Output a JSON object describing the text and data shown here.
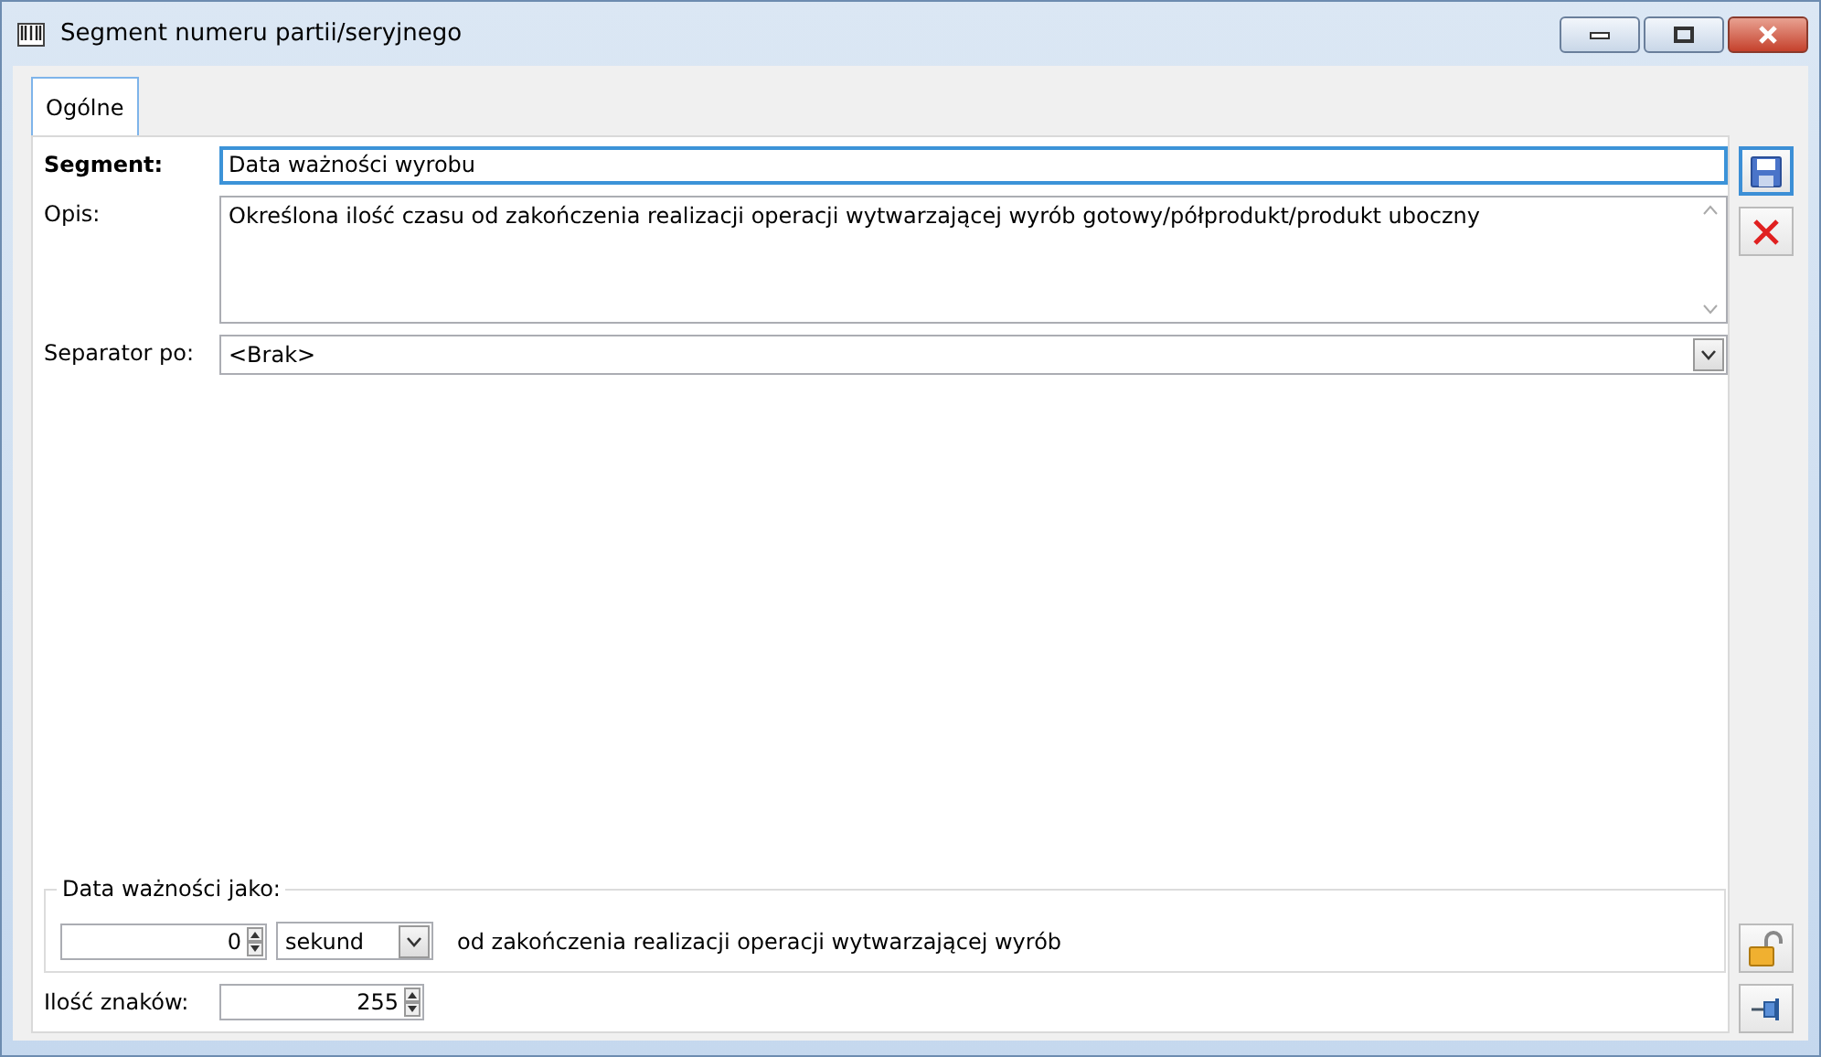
{
  "window": {
    "title": "Segment numeru partii/seryjnego"
  },
  "tabs": [
    {
      "label": "Ogólne",
      "selected": true
    }
  ],
  "form": {
    "segment": {
      "label": "Segment:",
      "value": "Data ważności wyrobu",
      "focused": true
    },
    "description": {
      "label": "Opis:",
      "value": "Określona ilość czasu od zakończenia realizacji operacji wytwarzającej wyrób gotowy/półprodukt/produkt uboczny"
    },
    "separator": {
      "label": "Separator po:",
      "value": "<Brak>"
    }
  },
  "expiry_group": {
    "title": "Data ważności jako:",
    "amount": "0",
    "unit": "sekund",
    "suffix": "od zakończenia realizacji operacji wytwarzającej wyrób"
  },
  "char_count": {
    "label": "Ilość znaków:",
    "value": "255"
  }
}
